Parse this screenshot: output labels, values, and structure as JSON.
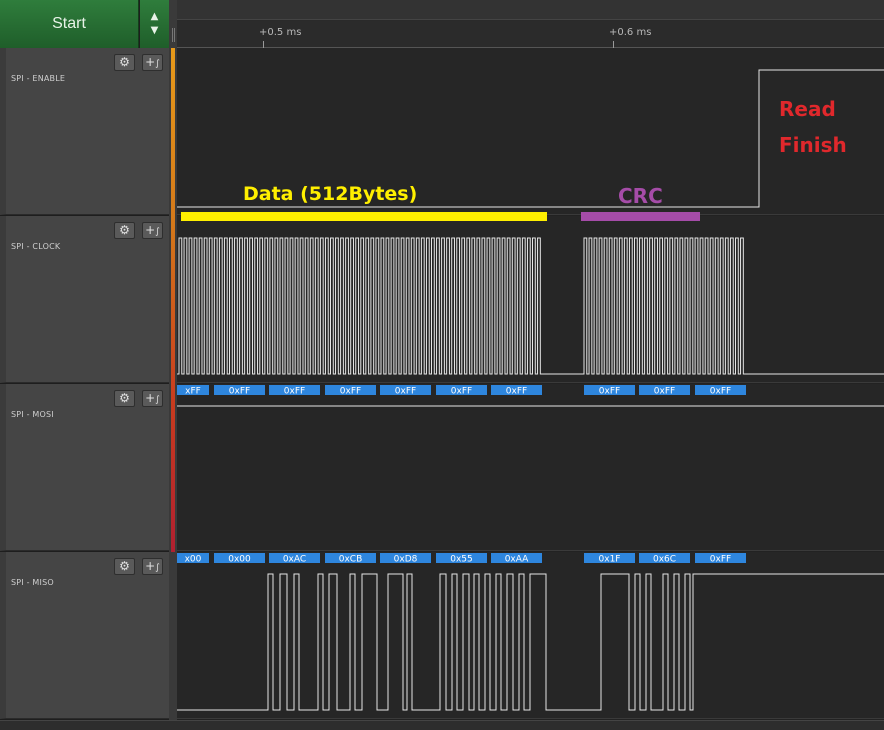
{
  "toolbar": {
    "start_label": "Start"
  },
  "ruler": {
    "ticks": [
      "+0.5 ms",
      "+0.6 ms"
    ]
  },
  "channels": [
    {
      "name": "SPI - ENABLE"
    },
    {
      "name": "SPI - CLOCK"
    },
    {
      "name": "SPI - MOSI"
    },
    {
      "name": "SPI - MISO"
    }
  ],
  "decoder": {
    "mosi": [
      "xFF",
      "0xFF",
      "0xFF",
      "0xFF",
      "0xFF",
      "0xFF",
      "0xFF",
      "0xFF",
      "0xFF",
      "0xFF"
    ],
    "miso": [
      "x00",
      "0x00",
      "0xAC",
      "0xCB",
      "0xD8",
      "0x55",
      "0xAA",
      "0x1F",
      "0x6C",
      "0xFF"
    ]
  },
  "annotations": {
    "data_label": "Data  (512Bytes)",
    "crc_label": "CRC",
    "read_finish_line1": "Read",
    "read_finish_line2": "Finish"
  },
  "colors": {
    "start_green": "#2f7d3c",
    "data_yellow": "#ffef00",
    "crc_purple": "#a54ca8",
    "read_finish_red": "#e0282c",
    "decoder_blue": "#2e86de",
    "waveform": "#e6e6e6"
  },
  "icons": {
    "settings": "gear-icon",
    "add_analyzer": "add-analyzer-icon",
    "scroll_up": "triangle-up-icon",
    "scroll_down": "triangle-down-icon"
  }
}
